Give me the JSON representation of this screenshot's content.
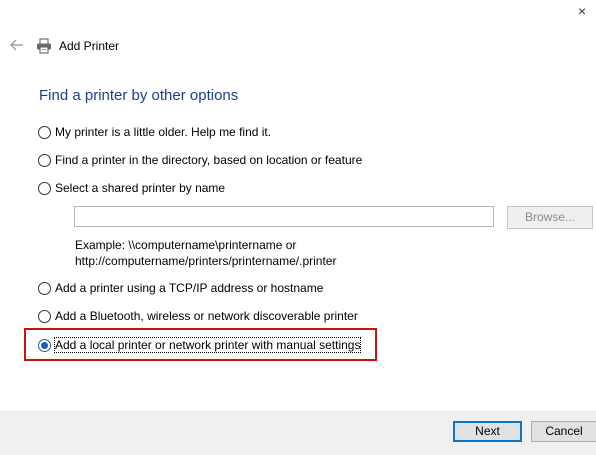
{
  "window": {
    "title": "Add Printer",
    "close_glyph": "×"
  },
  "icons": {
    "back": "back-arrow-icon",
    "printer": "printer-icon"
  },
  "heading": "Find a printer by other options",
  "options": [
    {
      "label": "My printer is a little older. Help me find it.",
      "checked": false
    },
    {
      "label": "Find a printer in the directory, based on location or feature",
      "checked": false
    },
    {
      "label": "Select a shared printer by name",
      "checked": false
    },
    {
      "label": "Add a printer using a TCP/IP address or hostname",
      "checked": false
    },
    {
      "label": "Add a Bluetooth, wireless or network discoverable printer",
      "checked": false
    },
    {
      "label": "Add a local printer or network printer with manual settings",
      "checked": true
    }
  ],
  "shared_printer": {
    "input_value": "",
    "browse_label": "Browse...",
    "example_line1": "Example: \\\\computername\\printername or",
    "example_line2": "http://computername/printers/printername/.printer"
  },
  "buttons": {
    "next": "Next",
    "cancel": "Cancel"
  },
  "colors": {
    "heading": "#1a3f8f",
    "highlight": "#d01010",
    "accent": "#0078d7"
  }
}
